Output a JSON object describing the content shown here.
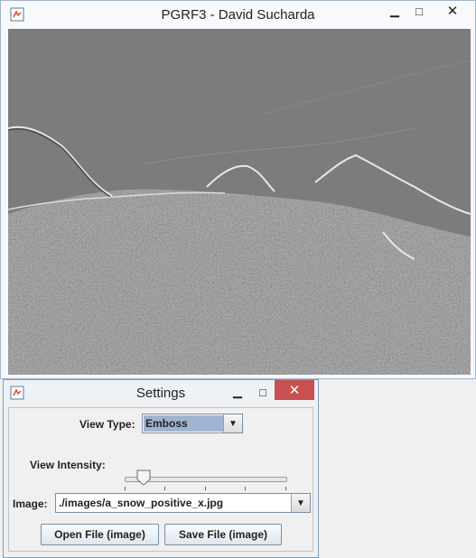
{
  "main_window": {
    "title": "PGRF3 - David Sucharda",
    "controls": {
      "minimize": "▁",
      "maximize": "□",
      "close": "✕"
    }
  },
  "settings": {
    "title": "Settings",
    "controls": {
      "minimize": "▁",
      "maximize": "□",
      "close": "✕"
    },
    "view_type_label": "View Type:",
    "view_type_value": "Emboss",
    "view_intensity_label": "View Intensity:",
    "intensity_value_percent": 12,
    "intensity_ticks": [
      "0",
      "25",
      "50",
      "75",
      "100"
    ],
    "image_label": "Image:",
    "image_value": "./images/a_snow_positive_x.jpg",
    "open_button": "Open File (image)",
    "save_button": "Save File (image)"
  },
  "colors": {
    "close_active": "#c75050",
    "selected_combo": "#9fb4d0",
    "canvas_gray": "#7d7d7d"
  }
}
